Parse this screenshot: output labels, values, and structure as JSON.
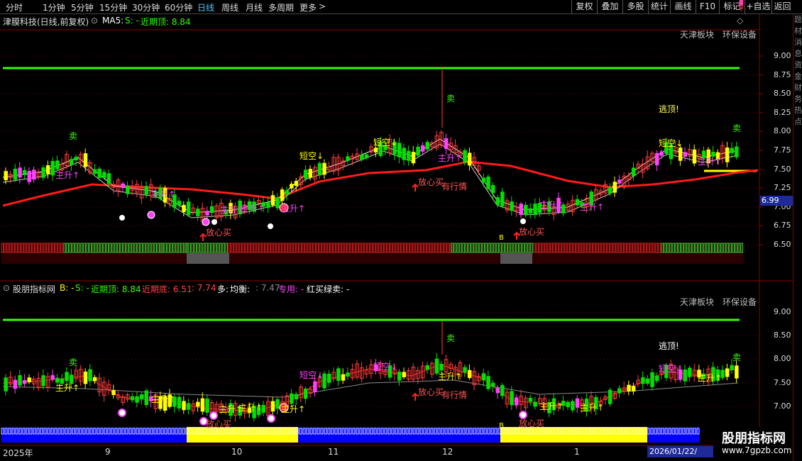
{
  "toolbar": {
    "periods": [
      "分时",
      "1分钟",
      "5分钟",
      "15分钟",
      "30分钟",
      "60分钟",
      "日线",
      "周线",
      "月线",
      "多周期",
      "更多"
    ],
    "active_period": "日线",
    "more_glyph": ">",
    "buttons": [
      "复权",
      "叠加",
      "多股",
      "统计",
      "画线",
      "F10",
      "标记",
      "+自选",
      "返回"
    ]
  },
  "main_panel": {
    "stock": "津膜科技(日线,前复权)",
    "indicator": "MA5:",
    "s_label": "S: -",
    "recent_top": "近期顶: 8.84",
    "sectors": [
      "天津板块",
      "环保设备"
    ],
    "price_ticks": [
      "9.00",
      "8.75",
      "8.50",
      "8.25",
      "8.00",
      "7.75",
      "7.50",
      "7.25",
      "7.00",
      "6.75",
      "6.50"
    ],
    "current_price": "6.99",
    "annotations": {
      "sell": "卖",
      "short": "短空↓",
      "zhusheng": "主升↑",
      "fangxin": "放心买",
      "youhang": "有行情",
      "taoding": "逃顶!",
      "b_mark": "B"
    }
  },
  "sub_panel": {
    "title": "股朋指标网",
    "b_label": "B: -",
    "s_label": "S: -",
    "recent_top": "近期顶: 8.84",
    "recent_bottom": "近期底: 6.51",
    "val2": ": 7.74",
    "duo": "多:",
    "junheng": "均衡:",
    "junheng_val": ": 7.47",
    "zhuanyong": "专用: -",
    "hongmai": "红买绿卖: -",
    "sectors": [
      "天津板块",
      "环保设备"
    ],
    "price_ticks": [
      "9.00",
      "8.50",
      "8.00",
      "7.50",
      "7.00"
    ],
    "annotations": {
      "sell": "卖",
      "short": "短空↓",
      "zhusheng": "主升↑",
      "fangxin": "放心买",
      "youhang": "有行情",
      "taoding": "逃顶!",
      "b_mark": "B"
    }
  },
  "timeline": {
    "labels": [
      "2025年",
      "9",
      "10",
      "11",
      "12",
      "1"
    ],
    "date_box": "2026/01/22/"
  },
  "right_column": "题材消息资金财务热点",
  "watermark": {
    "line1": "股朋指标网",
    "line2": "www.7gpzb.com"
  },
  "colors": {
    "up": "#ff3b3b",
    "down": "#00e000",
    "yellow": "#ffff00",
    "magenta": "#ff40ff",
    "grid_red": "#8b0000",
    "green_line": "#33ff00",
    "active_tab": "#4fc3f7",
    "blue_band": "#0000ff"
  }
}
